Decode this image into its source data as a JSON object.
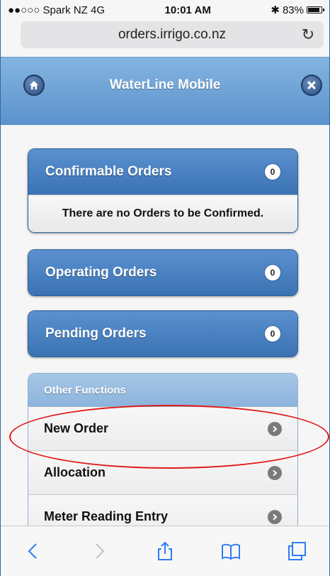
{
  "status_bar": {
    "carrier": "●●○○○ Spark NZ  4G",
    "time": "10:01 AM",
    "bluetooth": "✱",
    "battery_percent": "83%"
  },
  "browser": {
    "url": "orders.irrigo.co.nz"
  },
  "header": {
    "title": "WaterLine Mobile"
  },
  "cards": [
    {
      "title": "Confirmable Orders",
      "count": "0",
      "message": "There are no Orders to be Confirmed."
    },
    {
      "title": "Operating Orders",
      "count": "0"
    },
    {
      "title": "Pending Orders",
      "count": "0"
    }
  ],
  "other_functions": {
    "title": "Other Functions",
    "items": [
      {
        "label": "New Order"
      },
      {
        "label": "Allocation"
      },
      {
        "label": "Meter Reading Entry"
      }
    ]
  },
  "colors": {
    "header_blue": "#5b92cc",
    "button_blue": "#3a72b3",
    "annotation_red": "#e01919"
  }
}
